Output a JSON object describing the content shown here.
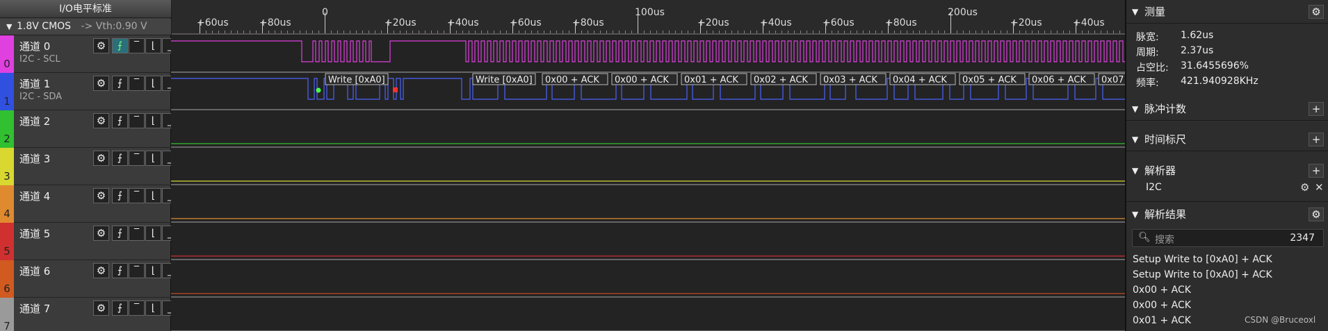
{
  "io_header": {
    "title": "I/O电平标准",
    "level": "1.8V CMOS",
    "vth": "-> Vth:0.90 V"
  },
  "ruler": {
    "ticks": [
      "+60us",
      "+80us",
      "0",
      "+20us",
      "+40us",
      "+60us",
      "+80us",
      "100us",
      "+20us",
      "+40us",
      "+60us",
      "+80us",
      "200us",
      "+20us",
      "+40us"
    ]
  },
  "channels": [
    {
      "num": "0",
      "name": "通道 0",
      "sub": "I2C - SCL",
      "color": "#e040e0",
      "signal_color": "#e040e0"
    },
    {
      "num": "1",
      "name": "通道 1",
      "sub": "I2C - SDA",
      "color": "#3050e0",
      "signal_color": "#4b63ff"
    },
    {
      "num": "2",
      "name": "通道 2",
      "sub": "",
      "color": "#30c030",
      "signal_color": "#30c030"
    },
    {
      "num": "3",
      "name": "通道 3",
      "sub": "",
      "color": "#d8d830",
      "signal_color": "#d8d830"
    },
    {
      "num": "4",
      "name": "通道 4",
      "sub": "",
      "color": "#e08a30",
      "signal_color": "#e08a30"
    },
    {
      "num": "5",
      "name": "通道 5",
      "sub": "",
      "color": "#d03030",
      "signal_color": "#d03030"
    },
    {
      "num": "6",
      "name": "通道 6",
      "sub": "",
      "color": "#d05a20",
      "signal_color": "#c04a20"
    },
    {
      "num": "7",
      "name": "通道 7",
      "sub": "",
      "color": "#9a9a9a",
      "signal_color": "#888888"
    }
  ],
  "decode_labels": [
    "Write [0xA0]",
    "Write [0xA0]",
    "0x00 + ACK",
    "0x00 + ACK",
    "0x01 + ACK",
    "0x02 + ACK",
    "0x03 + ACK",
    "0x04 + ACK",
    "0x05 + ACK",
    "0x06 + ACK",
    "0x07"
  ],
  "panel": {
    "measure": {
      "title": "测量",
      "rows": [
        {
          "k": "脉宽:",
          "v": "1.62us"
        },
        {
          "k": "周期:",
          "v": "2.37us"
        },
        {
          "k": "占空比:",
          "v": "31.6455696%"
        },
        {
          "k": "频率:",
          "v": "421.940928KHz"
        }
      ]
    },
    "pulse_count": "脉冲计数",
    "time_ruler": "时间标尺",
    "analyzer": {
      "title": "解析器",
      "item": "I2C"
    },
    "results": {
      "title": "解析结果",
      "search_placeholder": "搜索",
      "count": "2347",
      "items": [
        "Setup Write to [0xA0] + ACK",
        "Setup Write to [0xA0] + ACK",
        "0x00 + ACK",
        "0x00 + ACK",
        "0x01 + ACK"
      ]
    }
  },
  "watermark": "CSDN @Bruceoxl"
}
